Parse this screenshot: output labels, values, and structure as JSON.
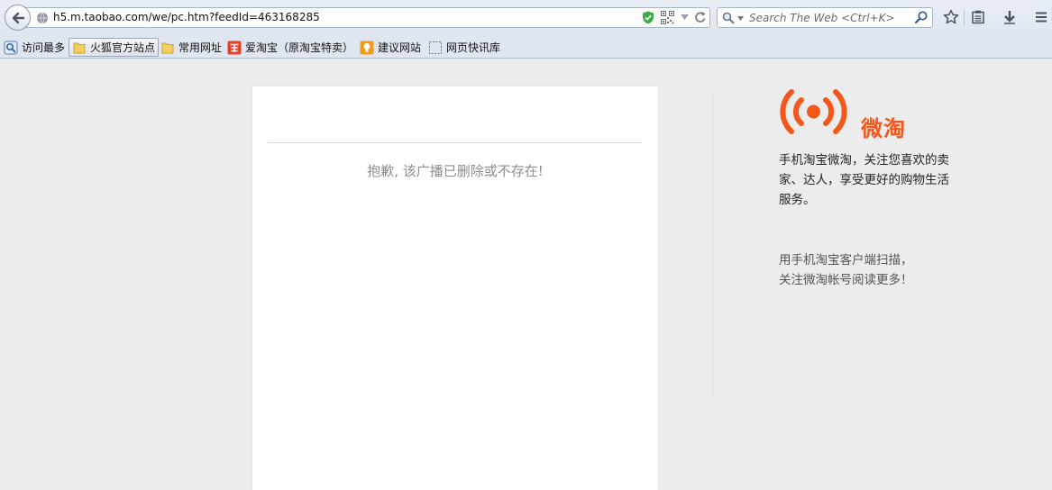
{
  "browser": {
    "url": "h5.m.taobao.com/we/pc.htm?feedId=463168285",
    "search_placeholder": "Search The Web <Ctrl+K>"
  },
  "bookmarks": [
    {
      "label": "访问最多",
      "icon": "most-visited-icon"
    },
    {
      "label": "火狐官方站点",
      "icon": "folder-icon"
    },
    {
      "label": "常用网址",
      "icon": "folder-icon"
    },
    {
      "label": "爱淘宝（原淘宝特卖）",
      "icon": "taobao-icon"
    },
    {
      "label": "建议网站",
      "icon": "bulb-icon"
    },
    {
      "label": "网页快讯库",
      "icon": "webslice-icon"
    }
  ],
  "content": {
    "error_message": "抱歉, 该广播已删除或不存在!"
  },
  "sidebar": {
    "brand": "微淘",
    "description": "手机淘宝微淘，关注您喜欢的卖家、达人，享受更好的购物生活服务。",
    "scan_line1": "用手机淘宝客户端扫描，",
    "scan_line2": "关注微淘帐号阅读更多！"
  },
  "colors": {
    "brand_orange": "#f2571b",
    "toolbar_bg": "#dfe6ef",
    "page_bg": "#ececec"
  }
}
